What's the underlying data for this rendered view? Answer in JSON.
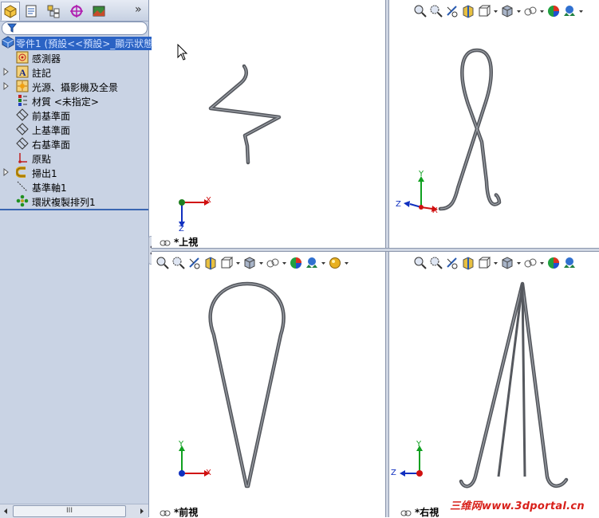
{
  "feature_manager": {
    "tabs": [
      {
        "name": "featuremanager-tab-icon",
        "active": true
      },
      {
        "name": "propertymanager-tab-icon",
        "active": false
      },
      {
        "name": "configurationmanager-tab-icon",
        "active": false
      },
      {
        "name": "dimxpert-tab-icon",
        "active": false
      },
      {
        "name": "display-manager-tab-icon",
        "active": false
      }
    ],
    "more_tabs": "»",
    "root": "零件1 (預設<<預設>_顯示狀態",
    "items": [
      {
        "label": "感測器",
        "icon": "sensor-icon",
        "expandable": false
      },
      {
        "label": "註記",
        "icon": "annotation-icon",
        "expandable": true
      },
      {
        "label": "光源、攝影機及全景",
        "icon": "lights-camera-icon",
        "expandable": true
      },
      {
        "label": "材質 <未指定>",
        "icon": "material-icon",
        "expandable": false
      },
      {
        "label": "前基準面",
        "icon": "plane-icon",
        "expandable": false
      },
      {
        "label": "上基準面",
        "icon": "plane-icon",
        "expandable": false
      },
      {
        "label": "右基準面",
        "icon": "plane-icon",
        "expandable": false
      },
      {
        "label": "原點",
        "icon": "origin-icon",
        "expandable": false
      },
      {
        "label": "掃出1",
        "icon": "sweep-icon",
        "expandable": true
      },
      {
        "label": "基準軸1",
        "icon": "axis-icon",
        "expandable": false
      },
      {
        "label": "環狀複製排列1",
        "icon": "circular-pattern-icon",
        "expandable": false
      }
    ],
    "scroll_thumb": "III"
  },
  "viewports": {
    "top_left": {
      "label": "*上視"
    },
    "bottom_left": {
      "label": "*前視"
    },
    "bottom_right": {
      "label": "*右視"
    }
  },
  "triads": {
    "top": [
      "X",
      "Z"
    ],
    "front": [
      "Y",
      "X"
    ],
    "right": [
      "Y",
      "Z"
    ],
    "iso": [
      "Y",
      "Z",
      "X"
    ]
  },
  "watermark": "三维网www.3dportal.cn",
  "colors": {
    "selection": "#2b63c4",
    "panel": "#c9d3e4",
    "model": "#6a6d74",
    "axis_x": "#d01010",
    "axis_y": "#10a020",
    "axis_z": "#1030c0",
    "watermark": "#d8201a"
  }
}
